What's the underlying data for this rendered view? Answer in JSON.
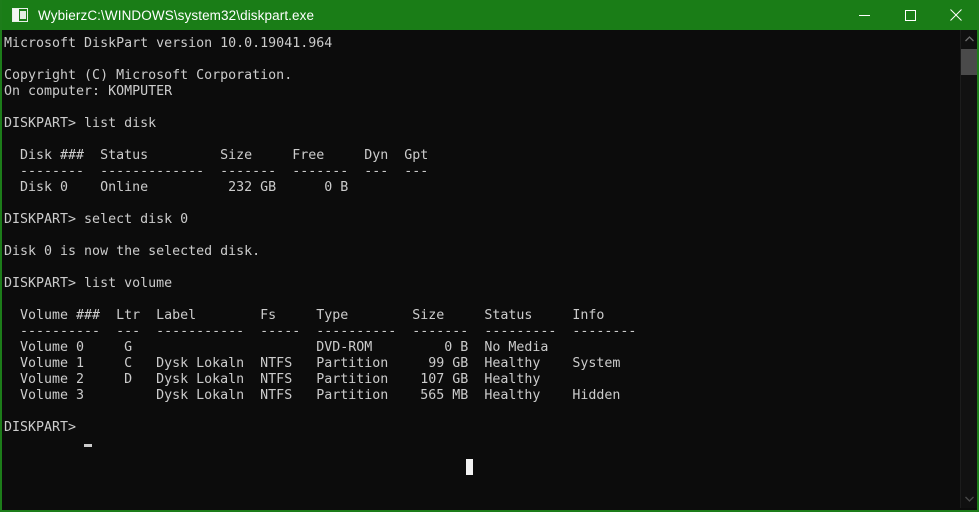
{
  "window": {
    "title": "WybierzC:\\WINDOWS\\system32\\diskpart.exe",
    "icon": "console-icon",
    "titlebar_color": "#1a7d17",
    "console_background": "#0c0c0c",
    "console_foreground": "#cccccc",
    "controls": {
      "minimize_label": "Minimize",
      "maximize_label": "Maximize",
      "close_label": "Close"
    }
  },
  "console": {
    "prompt": "DISKPART>",
    "cursor": "_",
    "header": {
      "product_line": "Microsoft DiskPart version 10.0.19041.964",
      "copyright_line": "Copyright (C) Microsoft Corporation.",
      "computer_line": "On computer: KOMPUTER"
    },
    "commands": {
      "list_disk": "list disk",
      "select_disk": "select disk 0",
      "list_volume": "list volume",
      "select_disk_response": "Disk 0 is now the selected disk."
    },
    "disk_table": {
      "headers": [
        "Disk ###",
        "Status",
        "Size",
        "Free",
        "Dyn",
        "Gpt"
      ],
      "separators": [
        "--------",
        "-------------",
        "-------",
        "-------",
        "---",
        "---"
      ],
      "rows": [
        {
          "disk": "Disk 0",
          "status": "Online",
          "size": "232 GB",
          "free": "0 B",
          "dyn": "",
          "gpt": ""
        }
      ]
    },
    "volume_table": {
      "headers": [
        "Volume ###",
        "Ltr",
        "Label",
        "Fs",
        "Type",
        "Size",
        "Status",
        "Info"
      ],
      "separators": [
        "----------",
        "---",
        "-----------",
        "-----",
        "----------",
        "-------",
        "---------",
        "--------"
      ],
      "rows": [
        {
          "volume": "Volume 0",
          "ltr": "G",
          "label": "",
          "fs": "",
          "type": "DVD-ROM",
          "size": "0 B",
          "status": "No Media",
          "info": ""
        },
        {
          "volume": "Volume 1",
          "ltr": "C",
          "label": "Dysk Lokaln",
          "fs": "NTFS",
          "type": "Partition",
          "size": "99 GB",
          "status": "Healthy",
          "info": "System"
        },
        {
          "volume": "Volume 2",
          "ltr": "D",
          "label": "Dysk Lokaln",
          "fs": "NTFS",
          "type": "Partition",
          "size": "107 GB",
          "status": "Healthy",
          "info": ""
        },
        {
          "volume": "Volume 3",
          "ltr": "",
          "label": "Dysk Lokaln",
          "fs": "NTFS",
          "type": "Partition",
          "size": "565 MB",
          "status": "Healthy",
          "info": "Hidden"
        }
      ]
    },
    "body_text": "Microsoft DiskPart version 10.0.19041.964\n\nCopyright (C) Microsoft Corporation.\nOn computer: KOMPUTER\n\nDISKPART> list disk\n\n  Disk ###  Status         Size     Free     Dyn  Gpt\n  --------  -------------  -------  -------  ---  ---\n  Disk 0    Online          232 GB      0 B\n\nDISKPART> select disk 0\n\nDisk 0 is now the selected disk.\n\nDISKPART> list volume\n\n  Volume ###  Ltr  Label        Fs     Type        Size     Status     Info\n  ----------  ---  -----------  -----  ----------  -------  ---------  --------\n  Volume 0     G                       DVD-ROM         0 B  No Media\n  Volume 1     C   Dysk Lokaln  NTFS   Partition     99 GB  Healthy    System\n  Volume 2     D   Dysk Lokaln  NTFS   Partition    107 GB  Healthy\n  Volume 3         Dysk Lokaln  NTFS   Partition    565 MB  Healthy    Hidden\n\nDISKPART>"
  },
  "scrollbar": {
    "up_arrow": "scroll-up-icon",
    "down_arrow": "scroll-down-icon",
    "thumb": "scroll-thumb"
  }
}
